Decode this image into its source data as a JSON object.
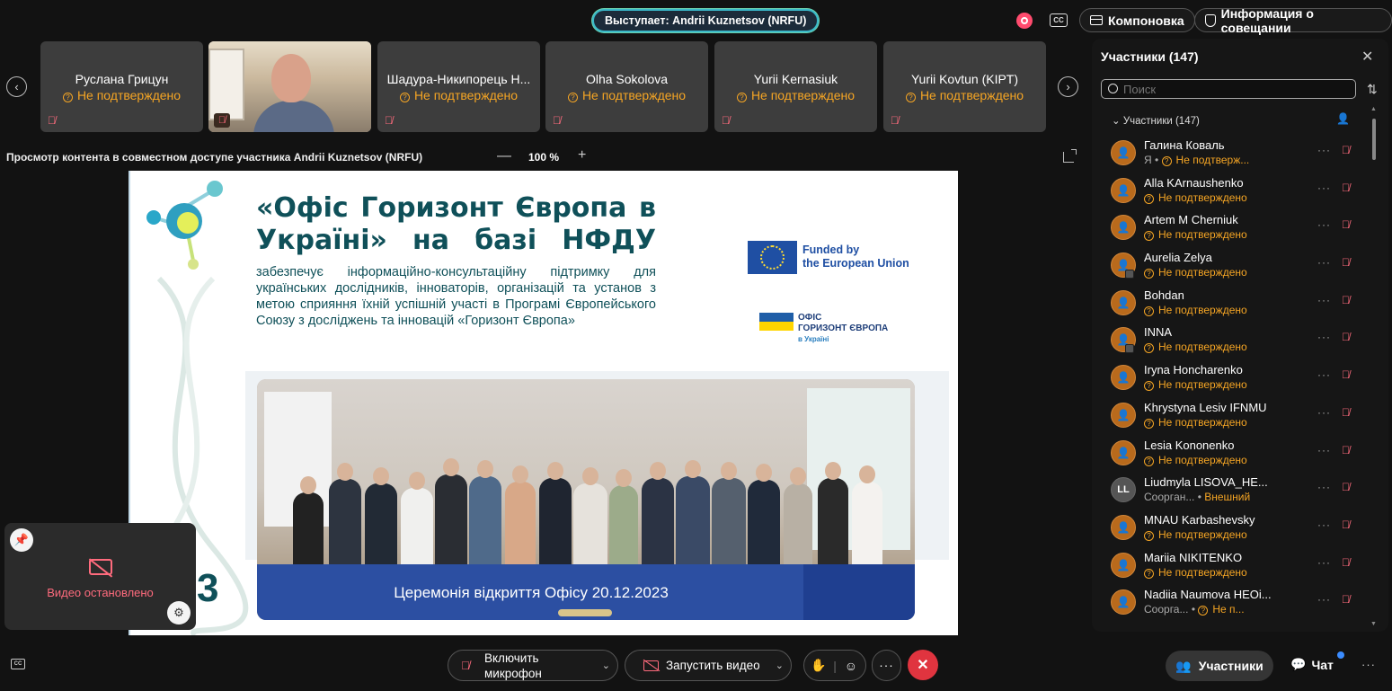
{
  "header": {
    "speaker": "Выступает: Andrii Kuznetsov (NRFU)",
    "cc_label": "CC",
    "layout_label": "Компоновка",
    "info_label": "Информация о совещании"
  },
  "thumbnails": [
    {
      "name": "Руслана Грицун",
      "status": "Не подтверждено"
    },
    {
      "name": "Шадура-Никипорець Н...",
      "status": "Не подтверждено"
    },
    {
      "name": "Olha Sokolova",
      "status": "Не подтверждено"
    },
    {
      "name": "Yurii Kernasiuk",
      "status": "Не подтверждено"
    },
    {
      "name": "Yurii Kovtun (KIPT)",
      "status": "Не подтверждено"
    }
  ],
  "share": {
    "title": "Просмотр контента в совместном доступе участника Andrii Kuznetsov (NRFU)",
    "zoom": "100 %",
    "minus": "—",
    "plus": "+"
  },
  "slide": {
    "title": "«Офіс Горизонт Європа в Україні» на базі НФДУ",
    "text": "забезпечує інформаційно-консультаційну підтримку для українських дослідників, інноваторів, організацій та установ з метою сприяння їхній успішній участі в Програмі Європейського Союзу з досліджень та інновацій «Горизонт Європа»",
    "funded_line1": "Funded by",
    "funded_line2": "the European Union",
    "office_line1": "ОФІС",
    "office_line2": "ГОРИЗОНТ ЄВРОПА",
    "office_line3": "в Україні",
    "caption": "Церемонія відкриття Офісу 20.12.2023",
    "big_digit": "3"
  },
  "selfview": {
    "status": "Видео остановлено"
  },
  "panel": {
    "title": "Участники (147)",
    "search_placeholder": "Поиск",
    "group": "Участники (147)",
    "participants": [
      {
        "name": "Галина Коваль",
        "pre": "Я",
        "status": "Не подтверж..."
      },
      {
        "name": "Alla KArnaushenko",
        "pre": "",
        "status": "Не подтверждено"
      },
      {
        "name": "Artem M Cherniuk",
        "pre": "",
        "status": "Не подтверждено"
      },
      {
        "name": "Aurelia Zelya",
        "pre": "",
        "status": "Не подтверждено"
      },
      {
        "name": "Bohdan",
        "pre": "",
        "status": "Не подтверждено"
      },
      {
        "name": "INNA",
        "pre": "",
        "status": "Не подтверждено"
      },
      {
        "name": "Iryna Honcharenko",
        "pre": "",
        "status": "Не подтверждено"
      },
      {
        "name": "Khrystyna Lesiv IFNMU",
        "pre": "",
        "status": "Не подтверждено"
      },
      {
        "name": "Lesia Kononenko",
        "pre": "",
        "status": "Не подтверждено"
      },
      {
        "name": "Liudmyla LISOVA_HE...",
        "pre": "Сооргaн...",
        "status": "Внешний",
        "initials": "LL"
      },
      {
        "name": "MNAU Karbashevsky",
        "pre": "",
        "status": "Не подтверждено"
      },
      {
        "name": "Mariia NIKITENKO",
        "pre": "",
        "status": "Не подтверждено"
      },
      {
        "name": "Nadiia Naumova HEOi...",
        "pre": "Соорга...",
        "status": "Не п..."
      }
    ]
  },
  "controls": {
    "mic_label": "Включить микрофон",
    "video_label": "Запустить видео",
    "participants_label": "Участники",
    "chat_label": "Чат"
  },
  "colors": {
    "pending": "#f5a524",
    "muted": "#ff6b7d",
    "end_call": "#e0343f",
    "slide_title": "#0f5059"
  }
}
